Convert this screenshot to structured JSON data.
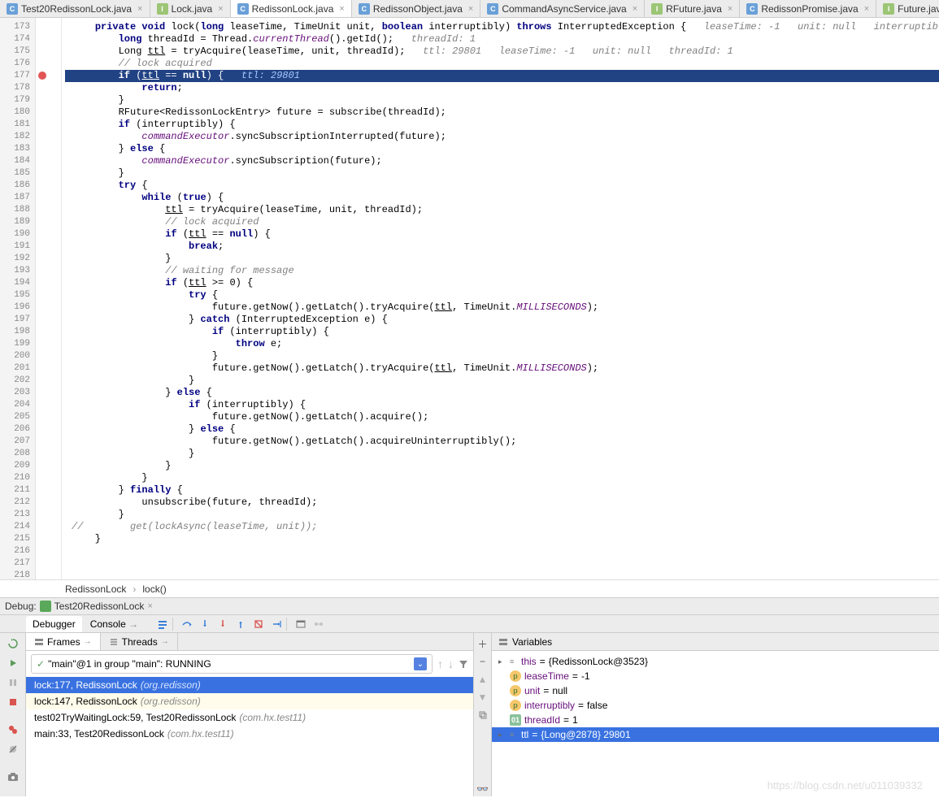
{
  "tabs": [
    {
      "icon": "class",
      "label": "Test20RedissonLock.java",
      "active": false
    },
    {
      "icon": "interface",
      "label": "Lock.java",
      "active": false
    },
    {
      "icon": "class",
      "label": "RedissonLock.java",
      "active": true
    },
    {
      "icon": "class",
      "label": "RedissonObject.java",
      "active": false
    },
    {
      "icon": "class",
      "label": "CommandAsyncService.java",
      "active": false
    },
    {
      "icon": "interface",
      "label": "RFuture.java",
      "active": false
    },
    {
      "icon": "class",
      "label": "RedissonPromise.java",
      "active": false
    },
    {
      "icon": "interface",
      "label": "Future.java",
      "active": false
    }
  ],
  "gutter_start": 173,
  "gutter_end": 218,
  "breakpoint_line": 177,
  "code_lines": [
    {
      "n": 173,
      "html": "    <span class='kw'>private void</span> lock(<span class='kw'>long</span> leaseTime, TimeUnit unit, <span class='kw'>boolean</span> interruptibly) <span class='kw'>throws</span> InterruptedException {   <span class='hint'>leaseTime: -1   unit: null   interruptibly: false</span>"
    },
    {
      "n": 174,
      "html": "        <span class='kw'>long</span> threadId = Thread.<span class='const'>currentThread</span>().getId();   <span class='hint'>threadId: 1</span>"
    },
    {
      "n": 175,
      "html": "        Long <span class='under'>ttl</span> = tryAcquire(leaseTime, unit, threadId);   <span class='hint'>ttl: 29801   leaseTime: -1   unit: null   threadId: 1</span>"
    },
    {
      "n": 176,
      "html": "        <span class='cmt'>// lock acquired</span>"
    },
    {
      "n": 177,
      "hl": true,
      "html": "        <span class='kw'>if</span> (<span class='under'>ttl</span> == <span class='kw'>null</span>) {   <span class='hint'>ttl: 29801</span>"
    },
    {
      "n": 178,
      "html": "            <span class='kw'>return</span>;"
    },
    {
      "n": 179,
      "html": "        }"
    },
    {
      "n": 180,
      "html": ""
    },
    {
      "n": 181,
      "html": "        RFuture&lt;RedissonLockEntry&gt; future = subscribe(threadId);"
    },
    {
      "n": 182,
      "html": "        <span class='kw'>if</span> (interruptibly) {"
    },
    {
      "n": 183,
      "html": "            <span class='const'>commandExecutor</span>.syncSubscriptionInterrupted(future);"
    },
    {
      "n": 184,
      "html": "        } <span class='kw'>else</span> {"
    },
    {
      "n": 185,
      "html": "            <span class='const'>commandExecutor</span>.syncSubscription(future);"
    },
    {
      "n": 186,
      "html": "        }"
    },
    {
      "n": 187,
      "html": ""
    },
    {
      "n": 188,
      "html": "        <span class='kw'>try</span> {"
    },
    {
      "n": 189,
      "html": "            <span class='kw'>while</span> (<span class='kw'>true</span>) {"
    },
    {
      "n": 190,
      "html": "                <span class='under'>ttl</span> = tryAcquire(leaseTime, unit, threadId);"
    },
    {
      "n": 191,
      "html": "                <span class='cmt'>// lock acquired</span>"
    },
    {
      "n": 192,
      "html": "                <span class='kw'>if</span> (<span class='under'>ttl</span> == <span class='kw'>null</span>) {"
    },
    {
      "n": 193,
      "html": "                    <span class='kw'>break</span>;"
    },
    {
      "n": 194,
      "html": "                }"
    },
    {
      "n": 195,
      "html": ""
    },
    {
      "n": 196,
      "html": "                <span class='cmt'>// waiting for message</span>"
    },
    {
      "n": 197,
      "html": "                <span class='kw'>if</span> (<span class='under'>ttl</span> &gt;= 0) {"
    },
    {
      "n": 198,
      "html": "                    <span class='kw'>try</span> {"
    },
    {
      "n": 199,
      "html": "                        future.getNow().getLatch().tryAcquire(<span class='under'>ttl</span>, TimeUnit.<span class='const'>MILLISECONDS</span>);"
    },
    {
      "n": 200,
      "html": "                    } <span class='kw'>catch</span> (InterruptedException e) {"
    },
    {
      "n": 201,
      "html": "                        <span class='kw'>if</span> (interruptibly) {"
    },
    {
      "n": 202,
      "html": "                            <span class='kw'>throw</span> e;"
    },
    {
      "n": 203,
      "html": "                        }"
    },
    {
      "n": 204,
      "html": "                        future.getNow().getLatch().tryAcquire(<span class='under'>ttl</span>, TimeUnit.<span class='const'>MILLISECONDS</span>);"
    },
    {
      "n": 205,
      "html": "                    }"
    },
    {
      "n": 206,
      "html": "                } <span class='kw'>else</span> {"
    },
    {
      "n": 207,
      "html": "                    <span class='kw'>if</span> (interruptibly) {"
    },
    {
      "n": 208,
      "html": "                        future.getNow().getLatch().acquire();"
    },
    {
      "n": 209,
      "html": "                    } <span class='kw'>else</span> {"
    },
    {
      "n": 210,
      "html": "                        future.getNow().getLatch().acquireUninterruptibly();"
    },
    {
      "n": 211,
      "html": "                    }"
    },
    {
      "n": 212,
      "html": "                }"
    },
    {
      "n": 213,
      "html": "            }"
    },
    {
      "n": 214,
      "html": "        } <span class='kw'>finally</span> {"
    },
    {
      "n": 215,
      "html": "            unsubscribe(future, threadId);"
    },
    {
      "n": 216,
      "html": "        }"
    },
    {
      "n": 217,
      "html": "<span class='cmt'>//        get(lockAsync(leaseTime, unit));</span>"
    },
    {
      "n": 218,
      "html": "    }"
    }
  ],
  "breadcrumb": [
    "RedissonLock",
    "lock()"
  ],
  "debug": {
    "label": "Debug:",
    "config": "Test20RedissonLock",
    "tabs": {
      "debugger": "Debugger",
      "console": "Console"
    },
    "frames_tab": "Frames",
    "threads_tab": "Threads",
    "thread": "\"main\"@1 in group \"main\": RUNNING",
    "frames": [
      {
        "loc": "lock:177, RedissonLock",
        "pkg": "(org.redisson)",
        "sel": true
      },
      {
        "loc": "lock:147, RedissonLock",
        "pkg": "(org.redisson)",
        "alt": true
      },
      {
        "loc": "test02TryWaitingLock:59, Test20RedissonLock",
        "pkg": "(com.hx.test11)"
      },
      {
        "loc": "main:33, Test20RedissonLock",
        "pkg": "(com.hx.test11)"
      }
    ],
    "vars_label": "Variables",
    "vars": [
      {
        "icon": "def",
        "name": "this",
        "val": "{RedissonLock@3523}",
        "expand": "closed"
      },
      {
        "icon": "p",
        "name": "leaseTime",
        "val": "-1"
      },
      {
        "icon": "p",
        "name": "unit",
        "val": "null"
      },
      {
        "icon": "p",
        "name": "interruptibly",
        "val": "false"
      },
      {
        "icon": "ol",
        "name": "threadId",
        "val": "1"
      },
      {
        "icon": "def",
        "name": "ttl",
        "val": "{Long@2878} 29801",
        "expand": "closed",
        "sel": true
      }
    ]
  },
  "watermark": "https://blog.csdn.net/u011039332"
}
